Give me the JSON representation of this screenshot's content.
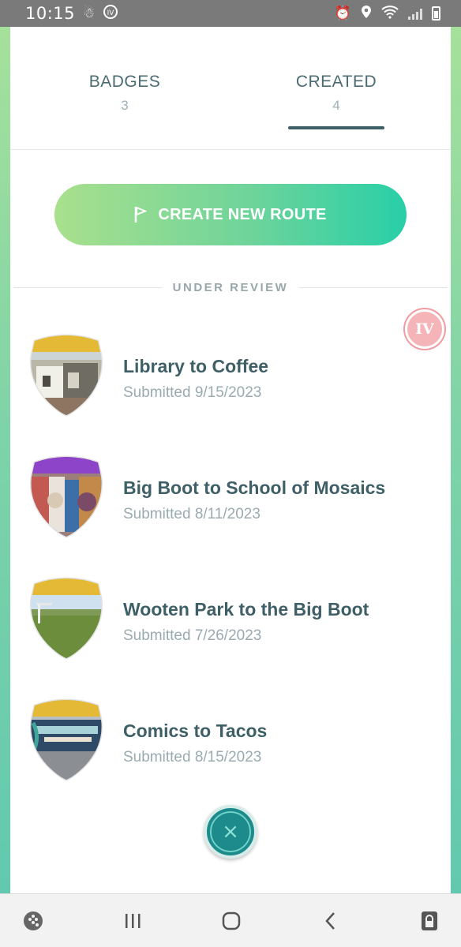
{
  "status_bar": {
    "time": "10:15",
    "left_icons": [
      "accessibility-icon",
      "iv-icon"
    ],
    "right_icons": [
      "alarm-icon",
      "location-icon",
      "wifi-icon",
      "signal-icon",
      "battery-icon"
    ]
  },
  "tabs": [
    {
      "label": "BADGES",
      "count": "3",
      "selected": false
    },
    {
      "label": "CREATED",
      "count": "4",
      "selected": true
    }
  ],
  "create_button": {
    "label": "CREATE NEW ROUTE",
    "icon": "flag-icon"
  },
  "section": {
    "title": "UNDER REVIEW"
  },
  "overlay_badge": {
    "text": "IV"
  },
  "routes": [
    {
      "name": "Library to Coffee",
      "date": "Submitted 9/15/2023",
      "banner_color": "#e3b935",
      "thumb": "building"
    },
    {
      "name": "Big Boot to School of Mosaics",
      "date": "Submitted 8/11/2023",
      "banner_color": "#8e44c9",
      "thumb": "mosaic"
    },
    {
      "name": "Wooten Park to the Big Boot",
      "date": "Submitted 7/26/2023",
      "banner_color": "#e3b935",
      "thumb": "park"
    },
    {
      "name": "Comics to Tacos",
      "date": "Submitted 8/15/2023",
      "banner_color": "#e3b935",
      "thumb": "storefront"
    }
  ],
  "close_button": {
    "label": "×",
    "icon": "close-icon"
  },
  "nav_bar": {
    "icons": [
      "game-launcher-icon",
      "recent-apps-icon",
      "home-icon",
      "back-icon",
      "lock-icon"
    ]
  },
  "colors": {
    "accent_gradient_start": "#a9e08d",
    "accent_gradient_end": "#28cfa8",
    "title_text": "#3f5f67",
    "muted_text": "#9aabb0",
    "close_button": "#1d8b8c"
  }
}
